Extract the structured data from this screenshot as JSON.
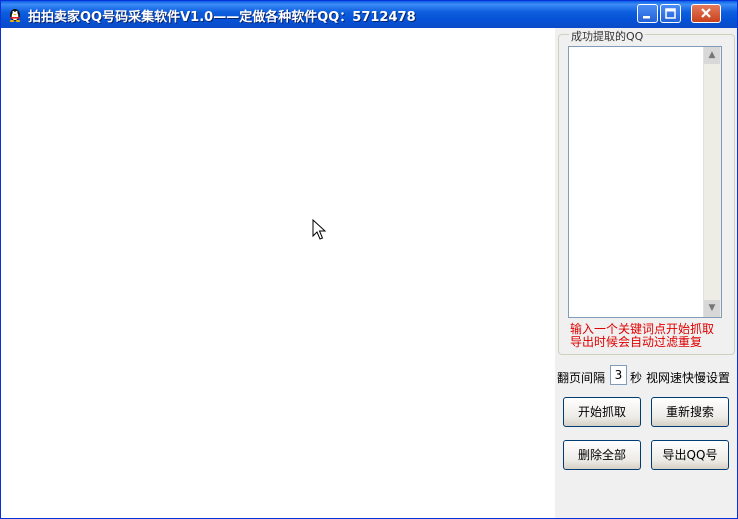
{
  "window": {
    "title": "拍拍卖家QQ号码采集软件V1.0——定做各种软件QQ：5712478",
    "icon": "qq-penguin-icon"
  },
  "panel": {
    "group_label": "成功提取的QQ",
    "hint_line1": "输入一个关键词点开始抓取",
    "hint_line2": "导出时候会自动过滤重复",
    "interval_label": "翻页间隔",
    "interval_value": "3",
    "interval_unit": "秒",
    "interval_note": "视网速快慢设置",
    "buttons": {
      "start": "开始抓取",
      "reset": "重新搜索",
      "clear_all": "删除全部",
      "export": "导出QQ号"
    }
  },
  "colors": {
    "title_bar": "#0A5FE6",
    "hint_text": "#E00000",
    "panel_bg": "#F0F0F0"
  }
}
